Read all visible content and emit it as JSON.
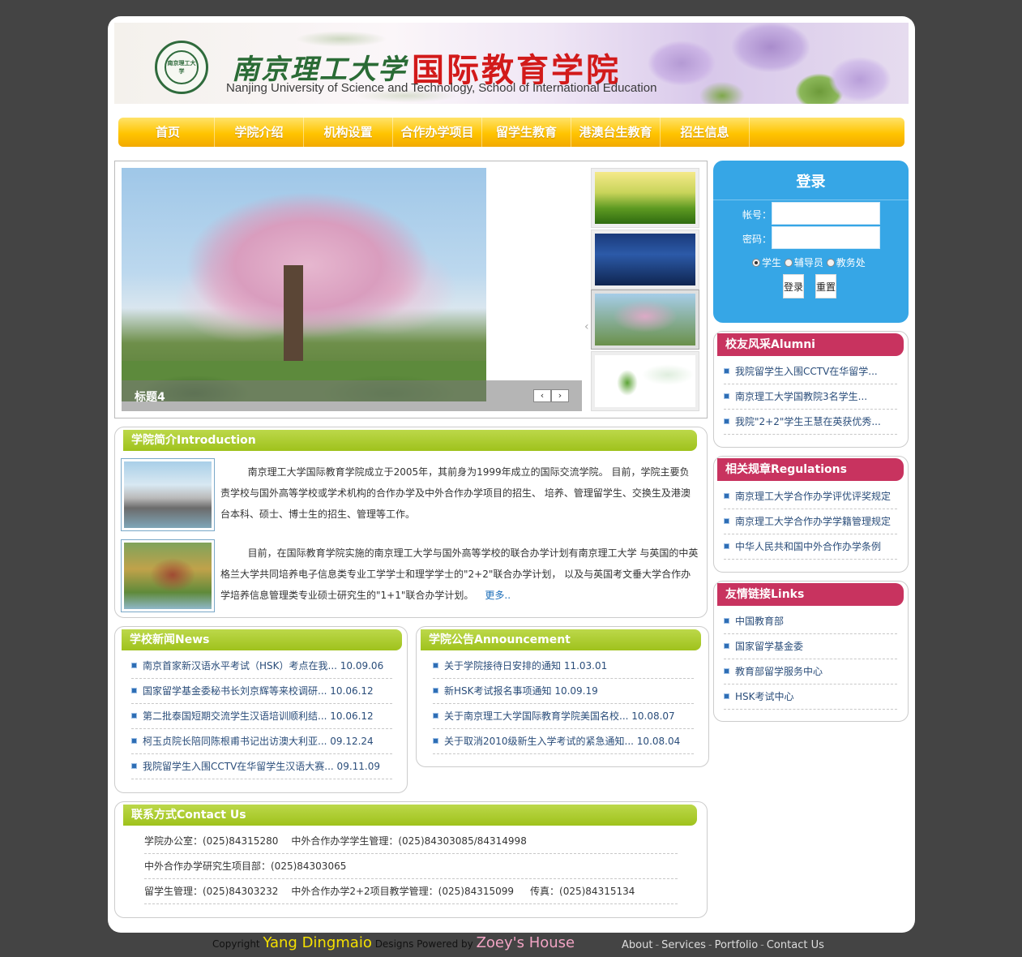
{
  "header": {
    "logo_text": "南京理工大学",
    "school_cn": "南京理工大学",
    "college_cn": "国际教育学院",
    "school_en": "Nanjing University of Science and Technology, School of International Education"
  },
  "nav": {
    "items": [
      {
        "label": "首页"
      },
      {
        "label": "学院介绍"
      },
      {
        "label": "机构设置"
      },
      {
        "label": "合作办学项目"
      },
      {
        "label": "留学生教育"
      },
      {
        "label": "港澳台生教育"
      },
      {
        "label": "招生信息"
      }
    ]
  },
  "slider": {
    "current_title": "标题4",
    "prev_symbol": "‹",
    "next_symbol": "›",
    "pointer_symbol": "‹",
    "active_thumb_index": 2
  },
  "intro": {
    "heading": "学院简介Introduction",
    "p1": "南京理工大学国际教育学院成立于2005年，其前身为1999年成立的国际交流学院。 目前，学院主要负责学校与国外高等学校或学术机构的合作办学及中外合作办学项目的招生、 培养、管理留学生、交换生及港澳台本科、硕士、博士生的招生、管理等工作。",
    "p2": "目前，在国际教育学院实施的南京理工大学与国外高等学校的联合办学计划有南京理工大学 与英国的中英格兰大学共同培养电子信息类专业工学学士和理学学士的\"2+2\"联合办学计划， 以及与英国考文垂大学合作办学培养信息管理类专业硕士研究生的\"1+1\"联合办学计划。",
    "more": "更多.."
  },
  "news": {
    "heading": "学校新闻News",
    "items": [
      {
        "text": "南京首家新汉语水平考试（HSK）考点在我... 10.09.06"
      },
      {
        "text": "国家留学基金委秘书长刘京辉等来校调研... 10.06.12"
      },
      {
        "text": "第二批泰国短期交流学生汉语培训顺利结... 10.06.12"
      },
      {
        "text": "柯玉贞院长陪同陈根甫书记出访澳大利亚... 09.12.24"
      },
      {
        "text": "我院留学生入围CCTV在华留学生汉语大赛... 09.11.09"
      }
    ]
  },
  "notice": {
    "heading": "学院公告Announcement",
    "items": [
      {
        "text": "关于学院接待日安排的通知 11.03.01"
      },
      {
        "text": "新HSK考试报名事项通知 10.09.19"
      },
      {
        "text": "关于南京理工大学国际教育学院美国名校... 10.08.07"
      },
      {
        "text": "关于取消2010级新生入学考试的紧急通知... 10.08.04"
      }
    ]
  },
  "contact": {
    "heading": "联系方式Contact Us",
    "office": "学院办公室：(025)84315280",
    "student_mgmt": "中外合作办学学生管理：(025)84303085/84314998",
    "grad_program": "中外合作办学研究生项目部：(025)84303065",
    "intl_student": "留学生管理：(025)84303232",
    "two_plus_two": "中外合作办学2+2项目教学管理：(025)84315099",
    "fax": "传真：(025)84315134"
  },
  "login": {
    "title": "登录",
    "account_label": "帐号：",
    "password_label": "密码：",
    "account_value": "",
    "password_value": "",
    "roles": [
      {
        "label": "学生",
        "selected": true
      },
      {
        "label": "辅导员",
        "selected": false
      },
      {
        "label": "教务处",
        "selected": false
      }
    ],
    "login_button": "登录",
    "reset_button": "重置"
  },
  "alumni": {
    "heading": "校友风采Alumni",
    "items": [
      {
        "text": "我院留学生入围CCTV在华留学..."
      },
      {
        "text": "南京理工大学国教院3名学生..."
      },
      {
        "text": "我院\"2+2\"学生王慧在英获优秀..."
      }
    ]
  },
  "rules": {
    "heading": "相关规章Regulations",
    "items": [
      {
        "text": "南京理工大学合作办学评优评奖规定"
      },
      {
        "text": "南京理工大学合作办学学籍管理规定"
      },
      {
        "text": "中华人民共和国中外合作办学条例"
      }
    ]
  },
  "links": {
    "heading": "友情链接Links",
    "items": [
      {
        "text": "中国教育部"
      },
      {
        "text": "国家留学基金委"
      },
      {
        "text": "教育部留学服务中心"
      },
      {
        "text": "HSK考试中心"
      }
    ]
  },
  "footer": {
    "copyright": "Copyright",
    "author": "Yang Dingmaio",
    "designs_by": "Designs Powered by",
    "house": "Zoey's House",
    "links": [
      {
        "label": "About"
      },
      {
        "label": "Services"
      },
      {
        "label": "Portfolio"
      },
      {
        "label": "Contact Us"
      }
    ],
    "separator": "-"
  }
}
